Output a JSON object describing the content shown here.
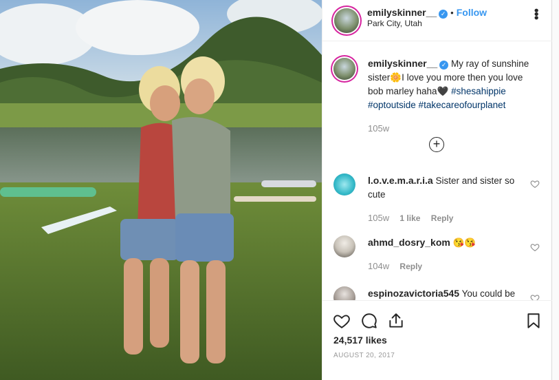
{
  "post": {
    "username": "emilyskinner__",
    "follow_label": "Follow",
    "location": "Park City, Utah",
    "more_icon": "more-options-icon"
  },
  "caption": {
    "username": "emilyskinner__",
    "text_1": "My ray of sunshine sister",
    "emoji_sun": "🌼",
    "text_2": "I love you more then you love bob marley haha",
    "emoji_heart": "🖤",
    "hashtags": "#shesahippie #optoutside #takecareofourplanet",
    "time_ago": "105w"
  },
  "comments": [
    {
      "username": "l.o.v.e.m.a.r.i.a",
      "text": "Sister and sister so cute",
      "time_ago": "105w",
      "likes": "1 like",
      "reply": "Reply"
    },
    {
      "username": "ahmd_dosry_kom",
      "text": "😘😘",
      "time_ago": "104w",
      "reply": "Reply"
    },
    {
      "username": "espinozavictoria545",
      "text": "You could be"
    }
  ],
  "likes_label": "24,517 likes",
  "date_label": "AUGUST 20, 2017",
  "colors": {
    "link": "#3897f0",
    "hashtag": "#003569",
    "muted": "#8e8e8e",
    "story_ring": "#d6249f"
  }
}
